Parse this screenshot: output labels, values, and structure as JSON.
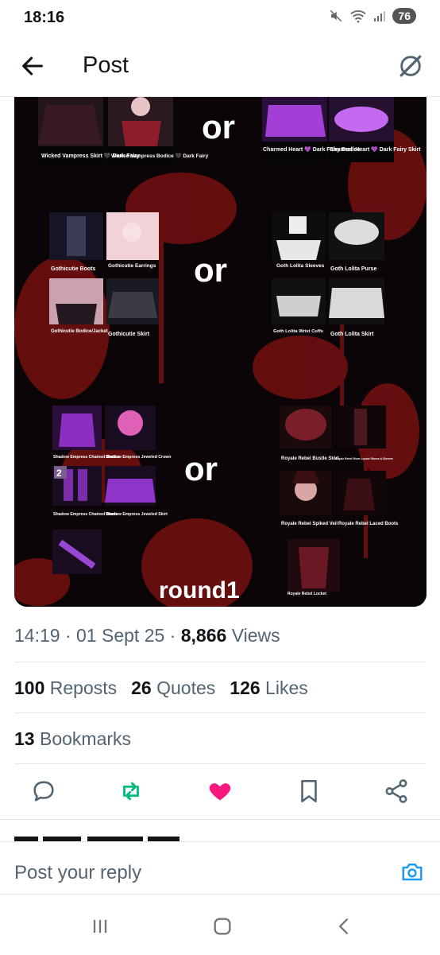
{
  "status_bar": {
    "time": "18:16",
    "battery": "76"
  },
  "header": {
    "title": "Post"
  },
  "media": {
    "overlay_words": [
      "or",
      "or",
      "or",
      "round1"
    ],
    "row1": {
      "left": [
        "Wicked Vampress Skirt 🖤 Dark Fairy",
        "Wicked Vampress Bodice 🖤 Dark Fairy"
      ],
      "right": [
        "Charmed Heart 💜 Dark Fairy Bodice",
        "Charmed Heart 💜 Dark Fairy Skirt"
      ]
    },
    "row2": {
      "left": [
        "Gothicutie Boots",
        "Gothicutie Earrings",
        "Gothicutie Bodice/Jacket",
        "Gothicutie Skirt"
      ],
      "right": [
        "Goth Lolita Sleeves",
        "Goth Lolita Purse",
        "Goth Lolita Wrist Cuffs",
        "Goth Lolita Skirt"
      ]
    },
    "row3": {
      "left": [
        "Shadow Empress Chained Bodice",
        "Shadow Empress Jeweled Crown",
        "Shadow Empress Chained Boots",
        "Shadow Empress Jeweled Skirt"
      ],
      "right": [
        "Royale Rebel Bustle Skirt",
        "Royale Rebel Sheer Locket Gloves & Sleeves",
        "Royale Rebel Spiked Veil",
        "Royale Rebel Laced Boots",
        "Royale Rebel Locket"
      ],
      "badge": "2"
    }
  },
  "meta": {
    "time": "14:19",
    "date": "01 Sept 25",
    "views_count": "8,866",
    "views_label": "Views"
  },
  "stats": {
    "reposts_count": "100",
    "reposts_label": "Reposts",
    "quotes_count": "26",
    "quotes_label": "Quotes",
    "likes_count": "126",
    "likes_label": "Likes",
    "bookmarks_count": "13",
    "bookmarks_label": "Bookmarks"
  },
  "reply": {
    "placeholder": "Post your reply"
  },
  "colors": {
    "repost": "#00ba7c",
    "like": "#f91880",
    "camera": "#1d9bf0"
  }
}
